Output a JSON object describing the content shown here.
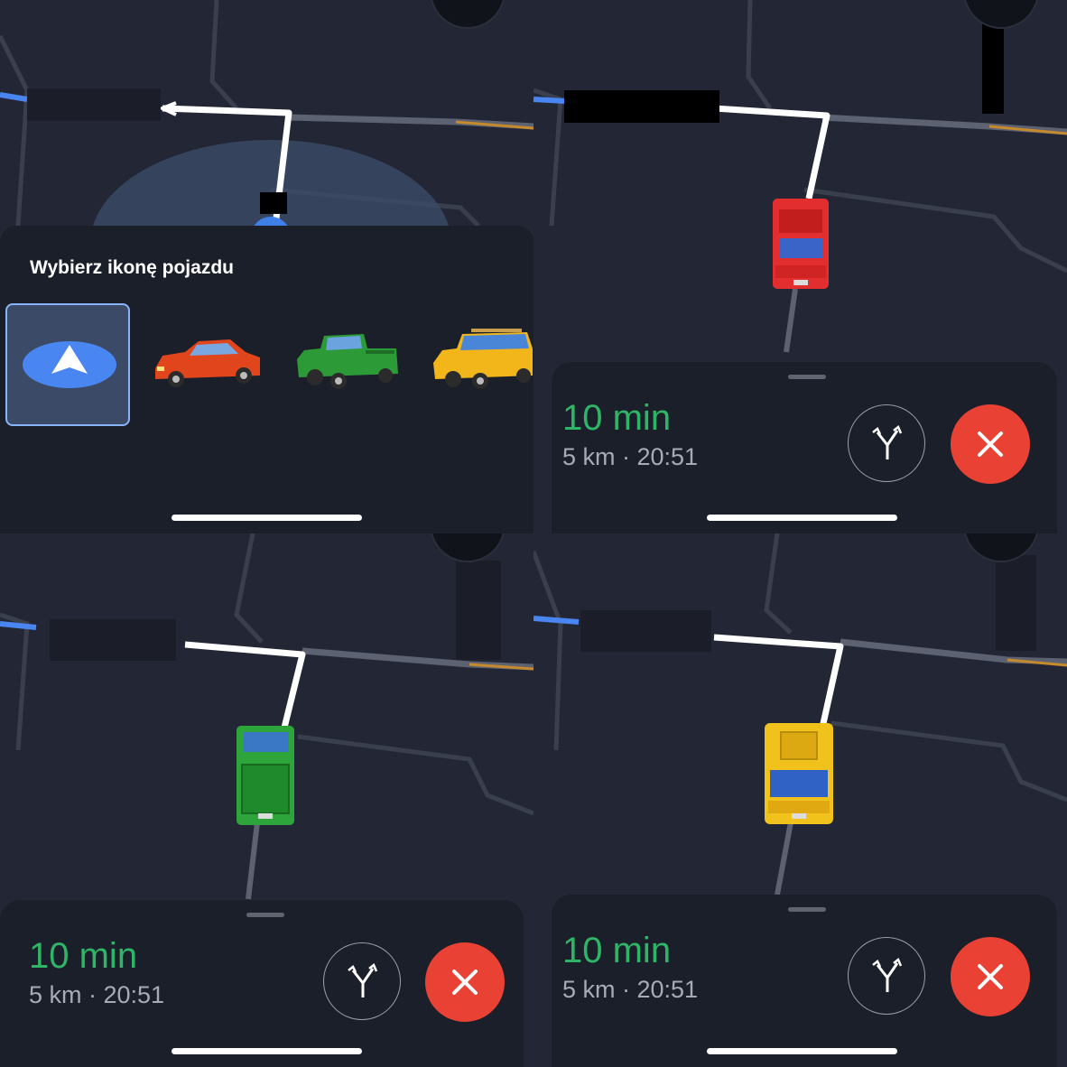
{
  "chooser": {
    "title": "Wybierz ikonę pojazdu",
    "options": [
      {
        "name": "navigation arrow",
        "color": "#4a86f2",
        "selected": true
      },
      {
        "name": "sedan",
        "color": "#e0451c",
        "selected": false
      },
      {
        "name": "pickup truck",
        "color": "#2d9a38",
        "selected": false
      },
      {
        "name": "suv",
        "color": "#f2b61b",
        "selected": false
      }
    ]
  },
  "navigation_panels": [
    {
      "vehicle": "red car",
      "eta": "10 min",
      "details": "5 km · 20:51"
    },
    {
      "vehicle": "green pickup truck",
      "eta": "10 min",
      "details": "5 km · 20:51"
    },
    {
      "vehicle": "yellow suv",
      "eta": "10 min",
      "details": "5 km · 20:51"
    }
  ],
  "colors": {
    "map_bg": "#232735",
    "route": "#ffffff",
    "eta_green": "#2fb568",
    "cancel_red": "#e94235",
    "selected_outline": "#8ab4f8"
  }
}
